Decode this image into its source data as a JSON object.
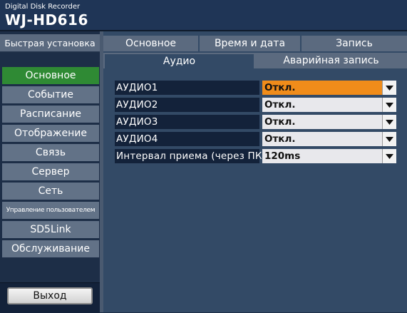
{
  "header": {
    "brand_sub": "Digital Disk Recorder",
    "model": "WJ-HD616"
  },
  "sidebar": {
    "quick_setup": "Быстрая установка",
    "items": [
      {
        "label": "Основное",
        "active": true
      },
      {
        "label": "Событие"
      },
      {
        "label": "Расписание"
      },
      {
        "label": "Отображение"
      },
      {
        "label": "Связь"
      },
      {
        "label": "Сервер"
      },
      {
        "label": "Сеть"
      },
      {
        "label": "Управление пользователем"
      },
      {
        "label": "SD5Link"
      },
      {
        "label": "Обслуживание"
      }
    ],
    "exit_label": "Выход"
  },
  "tabs": {
    "top": [
      {
        "label": "Основное"
      },
      {
        "label": "Время и дата"
      },
      {
        "label": "Запись"
      }
    ],
    "sub": [
      {
        "label": "Аудио",
        "active": true
      },
      {
        "label": "Аварийная запись"
      }
    ]
  },
  "settings": {
    "rows": [
      {
        "label": "АУДИО1",
        "value": "Откл.",
        "focused": true
      },
      {
        "label": "АУДИО2",
        "value": "Откл."
      },
      {
        "label": "АУДИО3",
        "value": "Откл."
      },
      {
        "label": "АУДИО4",
        "value": "Откл."
      },
      {
        "label": "Интервал приема (через ПК)",
        "value": "120ms"
      }
    ]
  },
  "colors": {
    "active_menu": "#2f8a34",
    "focused_select": "#f08c1a",
    "background": "#334a66"
  }
}
